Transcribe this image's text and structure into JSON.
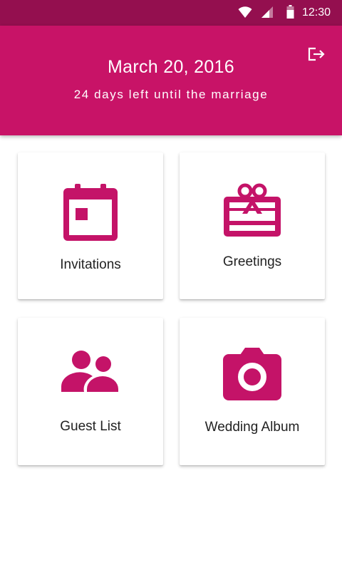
{
  "status_bar": {
    "time": "12:30",
    "icons": [
      "wifi-icon",
      "signal-icon",
      "battery-icon"
    ]
  },
  "header": {
    "date": "March 20, 2016",
    "countdown": "24 days left until the marriage",
    "action_icon": "logout-icon"
  },
  "menu": {
    "items": [
      {
        "label": "Invitations",
        "icon": "calendar-icon"
      },
      {
        "label": "Greetings",
        "icon": "gift-card-icon"
      },
      {
        "label": "Guest List",
        "icon": "people-icon"
      },
      {
        "label": "Wedding Album",
        "icon": "camera-icon"
      }
    ]
  },
  "colors": {
    "status_bar": "#940f4f",
    "header": "#c81367",
    "accent": "#c41368",
    "card_background": "#ffffff",
    "text": "#222222"
  }
}
